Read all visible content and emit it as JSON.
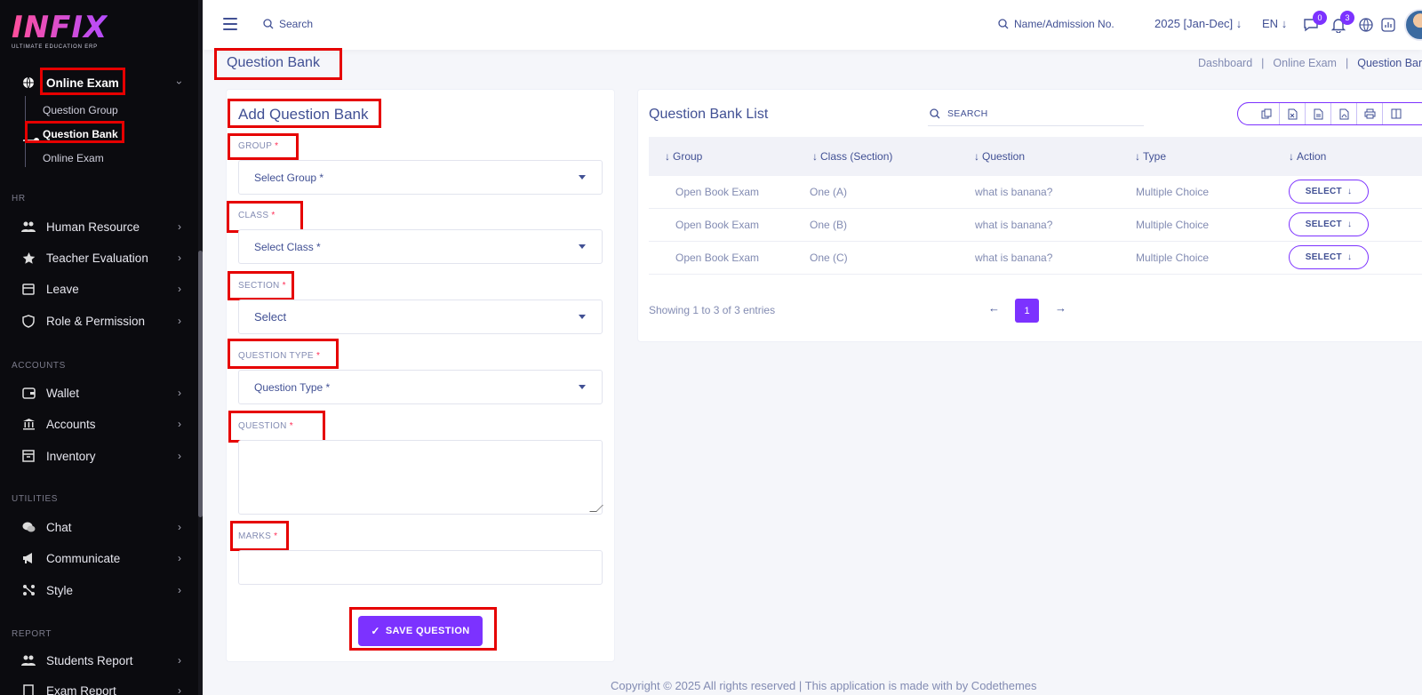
{
  "app": {
    "logo_main": "INFIX",
    "logo_sub": "ULTIMATE EDUCATION ERP",
    "accent_color": "#7c32ff",
    "highlight_color": "#e60000"
  },
  "sidebar": {
    "online_exam": {
      "label": "Online Exam",
      "icon": "globe-icon",
      "sub_items": [
        "Question Group",
        "Question Bank",
        "Online Exam"
      ]
    },
    "hr_label": "HR",
    "hr_items": [
      {
        "label": "Human Resource",
        "icon": "users-icon"
      },
      {
        "label": "Teacher Evaluation",
        "icon": "star-icon"
      },
      {
        "label": "Leave",
        "icon": "leave-icon"
      },
      {
        "label": "Role & Permission",
        "icon": "shield-icon"
      }
    ],
    "accounts_label": "ACCOUNTS",
    "accounts_items": [
      {
        "label": "Wallet",
        "icon": "wallet-icon"
      },
      {
        "label": "Accounts",
        "icon": "bank-icon"
      },
      {
        "label": "Inventory",
        "icon": "inventory-icon"
      }
    ],
    "utilities_label": "UTILITIES",
    "utilities_items": [
      {
        "label": "Chat",
        "icon": "chat-icon"
      },
      {
        "label": "Communicate",
        "icon": "megaphone-icon"
      },
      {
        "label": "Style",
        "icon": "style-icon"
      }
    ],
    "report_label": "REPORT",
    "report_items": [
      {
        "label": "Students Report",
        "icon": "users-icon"
      },
      {
        "label": "Exam Report",
        "icon": "report-icon"
      }
    ]
  },
  "topbar": {
    "search_label": "Search",
    "admission_search_label": "Name/Admission No.",
    "year": "2025 [Jan-Dec]",
    "lang": "EN",
    "messages_count": "0",
    "notifications_count": "3"
  },
  "page": {
    "title": "Question Bank",
    "breadcrumb": [
      "Dashboard",
      "Online Exam",
      "Question Bank"
    ]
  },
  "form": {
    "title": "Add Question Bank",
    "group_label": "GROUP",
    "group_placeholder": "Select Group *",
    "class_label": "CLASS",
    "class_placeholder": "Select Class *",
    "section_label": "SECTION",
    "section_value": "Select",
    "question_type_label": "QUESTION TYPE",
    "question_type_placeholder": "Question Type *",
    "question_label": "QUESTION",
    "marks_label": "MARKS",
    "required_mark": "*",
    "save_label": "SAVE QUESTION"
  },
  "list": {
    "title": "Question Bank List",
    "search_placeholder": "SEARCH",
    "columns": [
      "Group",
      "Class (Section)",
      "Question",
      "Type",
      "Action"
    ],
    "rows": [
      {
        "group": "Open Book Exam",
        "class_section": "One (A)",
        "question": "what is banana?",
        "type": "Multiple Choice",
        "action": "SELECT"
      },
      {
        "group": "Open Book Exam",
        "class_section": "One (B)",
        "question": "what is banana?",
        "type": "Multiple Choice",
        "action": "SELECT"
      },
      {
        "group": "Open Book Exam",
        "class_section": "One (C)",
        "question": "what is banana?",
        "type": "Multiple Choice",
        "action": "SELECT"
      }
    ],
    "entries_text": "Showing 1 to 3 of 3 entries",
    "current_page": "1",
    "toolbar_icons": [
      "copy-icon",
      "excel-icon",
      "csv-icon",
      "pdf-icon",
      "print-icon",
      "columns-icon"
    ]
  },
  "footer": {
    "text": "Copyright © 2025 All rights reserved | This application is made with by Codethemes"
  }
}
